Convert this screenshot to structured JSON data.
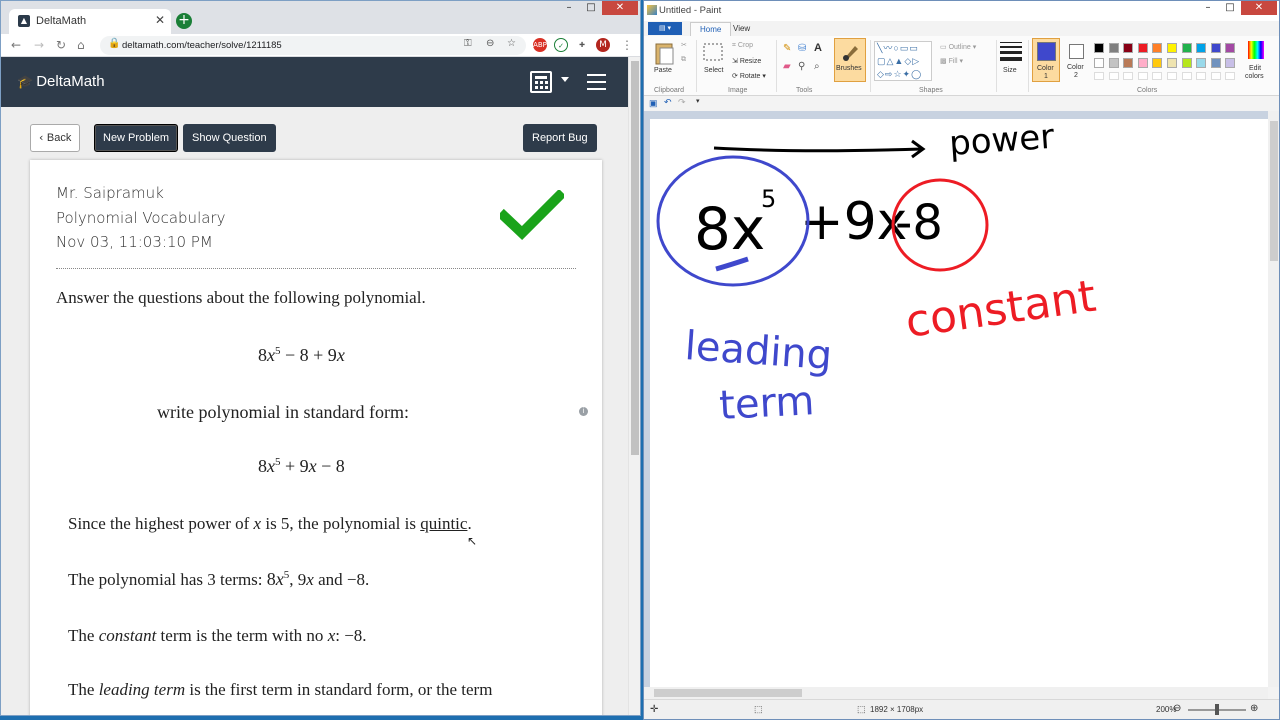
{
  "browser": {
    "tab_title": "DeltaMath",
    "url": "deltamath.com/teacher/solve/1211185",
    "profile_initial": "M"
  },
  "deltamath": {
    "logo": "DeltaMath",
    "buttons": {
      "back": "Back",
      "new_problem": "New Problem",
      "show_question": "Show Question",
      "report_bug": "Report Bug"
    },
    "teacher": "Mr. Saipramuk",
    "assignment": "Polynomial Vocabulary",
    "timestamp": "Nov 03, 11:03:10 PM",
    "prompt": "Answer the questions about the following polynomial.",
    "polynomial": {
      "c1": "8",
      "x1": "x",
      "e1": "5",
      "rest_a": " − 8 + 9",
      "x2": "x"
    },
    "standard_form_label": "write polynomial in standard form:",
    "standard_form": {
      "c1": "8",
      "x1": "x",
      "e1": "5",
      "rest_a": " + 9",
      "x2": "x",
      "rest_b": " − 8"
    },
    "explanation": {
      "line1_a": "Since the highest power of ",
      "line1_var": "x",
      "line1_b": " is 5, the polynomial is ",
      "line1_link": "quintic",
      "line1_c": ".",
      "line2_a": "The polynomial has 3 terms:  ",
      "line2_t1": "8",
      "line2_tx": "x",
      "line2_te": "5",
      "line2_b": ",  9",
      "line2_tx2": "x",
      "line2_c": " and −8.",
      "line3_a": "The ",
      "line3_em": "constant",
      "line3_b": " term is the term with no ",
      "line3_var": "x",
      "line3_c": ":   −8.",
      "line4_a": "The ",
      "line4_em": "leading term",
      "line4_b": " is the first term in standard form, or the term"
    },
    "colors": {
      "header": "#2e3b4a",
      "check": "#1aa31a"
    }
  },
  "paint": {
    "title": "Untitled - Paint",
    "tabs": {
      "home": "Home",
      "view": "View"
    },
    "ribbon": {
      "paste": "Paste",
      "clipboard": "Clipboard",
      "crop": "Crop",
      "resize": "Resize",
      "rotate": "Rotate",
      "select": "Select",
      "image": "Image",
      "tools": "Tools",
      "brushes": "Brushes",
      "outline": "Outline",
      "fill": "Fill",
      "shapes": "Shapes",
      "size": "Size",
      "color1": "Color\n1",
      "color1_a": "Color",
      "color1_b": "1",
      "color2_a": "Color",
      "color2_b": "2",
      "colors": "Colors",
      "edit_a": "Edit",
      "edit_b": "colors"
    },
    "drawing": {
      "power": "power",
      "expr_a": "8x",
      "expr_exp": "5",
      "expr_b": "+9x",
      "expr_c": "-8",
      "leading_a": "leading",
      "leading_b": "term",
      "constant": "constant"
    },
    "status": {
      "size": "1892 × 1708px",
      "zoom": "200%"
    },
    "palette": [
      "#000000",
      "#7f7f7f",
      "#880015",
      "#ed1c24",
      "#ff7f27",
      "#fff200",
      "#22b14c",
      "#00a2e8",
      "#3f48cc",
      "#a349a4",
      "#ffffff",
      "#c3c3c3",
      "#b97a57",
      "#ffaec9",
      "#ffc90e",
      "#efe4b0",
      "#b5e61d",
      "#99d9ea",
      "#7092be",
      "#c8bfe7"
    ],
    "ink_colors": {
      "black": "#000000",
      "blue": "#3f48cc",
      "red": "#ed1c24"
    }
  }
}
